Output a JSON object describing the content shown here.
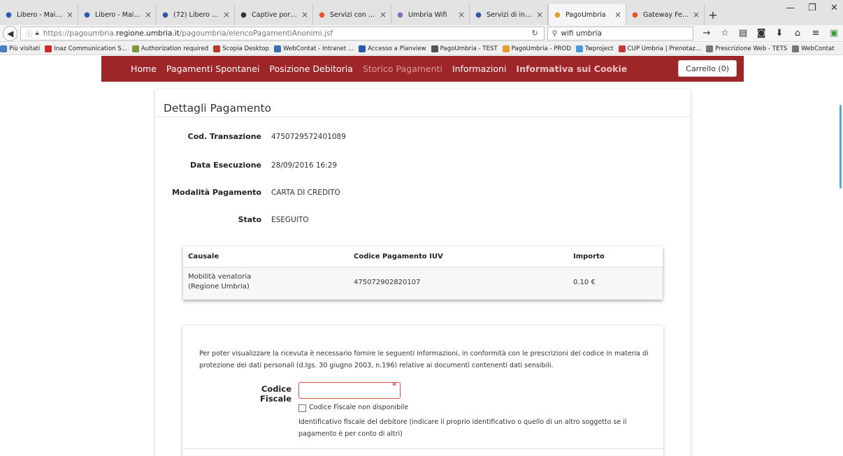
{
  "browser": {
    "tabs": [
      {
        "label": "Libero - Mail, ...",
        "icon": "libero-icon",
        "color": "#2a5aa8"
      },
      {
        "label": "Libero - Mail, ...",
        "icon": "libero-icon",
        "color": "#2a5aa8"
      },
      {
        "label": "(72) Libero M...",
        "icon": "libero-icon",
        "color": "#2a5aa8"
      },
      {
        "label": "Captive porta...",
        "icon": "wikipedia-icon",
        "color": "#333333"
      },
      {
        "label": "Servizi con ac...",
        "icon": "servizi-icon",
        "color": "#e8552c"
      },
      {
        "label": "Umbria Wifi",
        "icon": "umbria-wifi-icon",
        "color": "#8e6bbf"
      },
      {
        "label": "Servizi di inte...",
        "icon": "servizi-x-icon",
        "color": "#2a5aa8"
      },
      {
        "label": "PagoUmbria",
        "icon": "pagoumbria-icon",
        "color": "#e0a030",
        "active": true
      },
      {
        "label": "Gateway FedE...",
        "icon": "gateway-icon",
        "color": "#e8552c"
      }
    ],
    "url_prefix": "https://pagoumbria.",
    "url_domain": "regione.umbria.it",
    "url_path": "/pagoumbria/elencoPagamentiAnonimi.jsf",
    "search_value": "wifi umbria",
    "bookmarks": [
      {
        "label": "Più visitati",
        "color": "#4a7dc0"
      },
      {
        "label": "Inaz Communication S...",
        "color": "#cc2a2a"
      },
      {
        "label": "Authorization required",
        "color": "#7a9a3a"
      },
      {
        "label": "Scopia Desktop",
        "color": "#b83a2a"
      },
      {
        "label": "WebContat - Intranet ...",
        "color": "#3a70b0"
      },
      {
        "label": "Accesso a Planview",
        "color": "#2a5aa8"
      },
      {
        "label": "PagoUmbria - TEST",
        "color": "#555555"
      },
      {
        "label": "PagoUmbria - PROD",
        "color": "#e0a030"
      },
      {
        "label": "Twproject",
        "color": "#4a9ad8"
      },
      {
        "label": "CUP Umbria | Prenotaz...",
        "color": "#c83a3a"
      },
      {
        "label": "Prescrizione Web - TETS",
        "color": "#777777"
      },
      {
        "label": "WebContat",
        "color": "#777777"
      }
    ]
  },
  "site_nav": {
    "items": [
      {
        "label": "Home",
        "style": "normal"
      },
      {
        "label": "Pagamenti Spontanei",
        "style": "normal"
      },
      {
        "label": "Posizione Debitoria",
        "style": "normal"
      },
      {
        "label": "Storico Pagamenti",
        "style": "muted"
      },
      {
        "label": "Informazioni",
        "style": "normal"
      },
      {
        "label": "Informativa sui Cookie",
        "style": "bold"
      }
    ],
    "cart_label": "Carrello (0)",
    "brand_color": "#9e2528"
  },
  "details": {
    "title": "Dettagli Pagamento",
    "fields": [
      {
        "label": "Cod. Transazione",
        "value": "4750729572401089"
      },
      {
        "label": "Data Esecuzione",
        "value": "28/09/2016 16:29"
      },
      {
        "label": "Modalità Pagamento",
        "value": "CARTA DI CREDITO"
      },
      {
        "label": "Stato",
        "value": "ESEGUITO"
      }
    ],
    "table": {
      "headers": [
        "Causale",
        "Codice Pagamento IUV",
        "Importo"
      ],
      "rows": [
        {
          "causale_line1": "Mobilità venatoria",
          "causale_line2": "(Regione Umbria)",
          "iuv": "475072902820107",
          "importo": "0.10 €"
        }
      ]
    }
  },
  "receipt": {
    "intro": "Per poter visualizzare la ricevuta è necessario fornire le seguenti informazioni, in conformità con le prescrizioni del codice in materia di protezione dei dati personali (d.lgs. 30 giugno 2003, n.196) relative ai documenti contenenti dati sensibili.",
    "cf_label": "Codice Fiscale",
    "cf_value": "",
    "cf_unavailable_label": "Codice Fiscale non disponibile",
    "help_text": "Identificativo fiscale del debitore (indicare il proprio identificativo o quello di un altro soggetto se il pagamento è per conto di altri)"
  }
}
